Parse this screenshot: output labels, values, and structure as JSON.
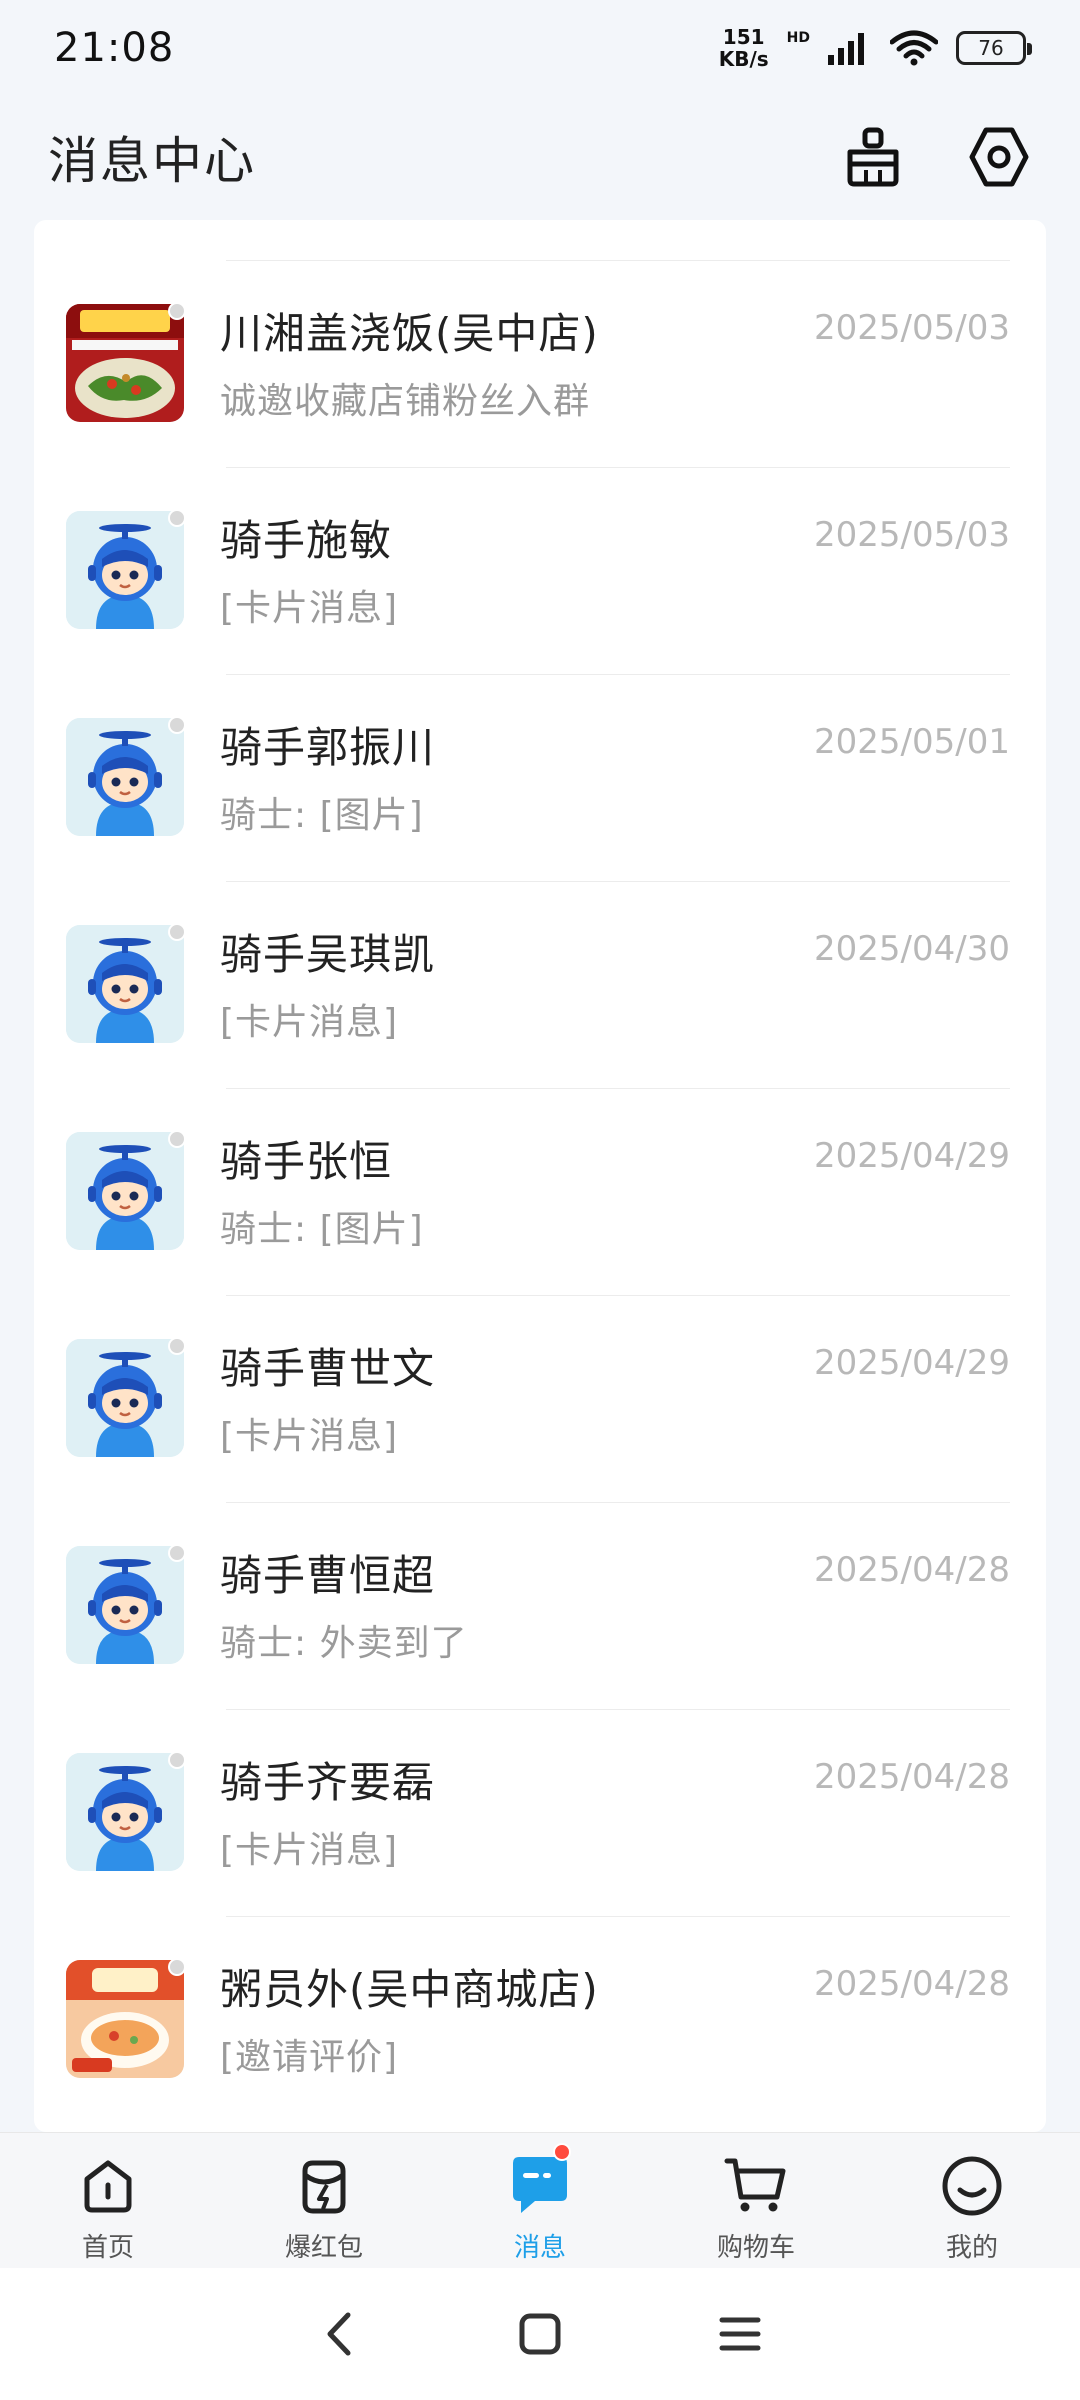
{
  "status": {
    "time": "21:08",
    "net_speed_value": "151",
    "net_speed_unit": "KB/s",
    "hd": "HD",
    "battery": "76"
  },
  "header": {
    "title": "消息中心",
    "clean_icon": "broom-icon",
    "settings_icon": "gear-icon"
  },
  "messages": [
    {
      "name": "川湘盖浇饭(吴中店)",
      "date": "2025/05/03",
      "preview": "诚邀收藏店铺粉丝入群",
      "avatar": "store"
    },
    {
      "name": "骑手施敏",
      "date": "2025/05/03",
      "preview": "[卡片消息]",
      "avatar": "rider"
    },
    {
      "name": "骑手郭振川",
      "date": "2025/05/01",
      "preview": "骑士: [图片]",
      "avatar": "rider"
    },
    {
      "name": "骑手吴琪凯",
      "date": "2025/04/30",
      "preview": "[卡片消息]",
      "avatar": "rider"
    },
    {
      "name": "骑手张恒",
      "date": "2025/04/29",
      "preview": "骑士: [图片]",
      "avatar": "rider"
    },
    {
      "name": "骑手曹世文",
      "date": "2025/04/29",
      "preview": "[卡片消息]",
      "avatar": "rider"
    },
    {
      "name": "骑手曹恒超",
      "date": "2025/04/28",
      "preview": "骑士: 外卖到了",
      "avatar": "rider"
    },
    {
      "name": "骑手齐要磊",
      "date": "2025/04/28",
      "preview": "[卡片消息]",
      "avatar": "rider"
    },
    {
      "name": "粥员外(吴中商城店)",
      "date": "2025/04/28",
      "preview": "[邀请评价]",
      "avatar": "store2"
    }
  ],
  "nav": [
    {
      "label": "首页",
      "icon": "home-icon"
    },
    {
      "label": "爆红包",
      "icon": "red-packet-icon"
    },
    {
      "label": "消息",
      "icon": "message-icon",
      "active": true
    },
    {
      "label": "购物车",
      "icon": "cart-icon"
    },
    {
      "label": "我的",
      "icon": "profile-icon"
    }
  ],
  "colors": {
    "accent": "#1e9fe8",
    "badge": "#ff4b3e",
    "background": "#f3f6fa"
  }
}
